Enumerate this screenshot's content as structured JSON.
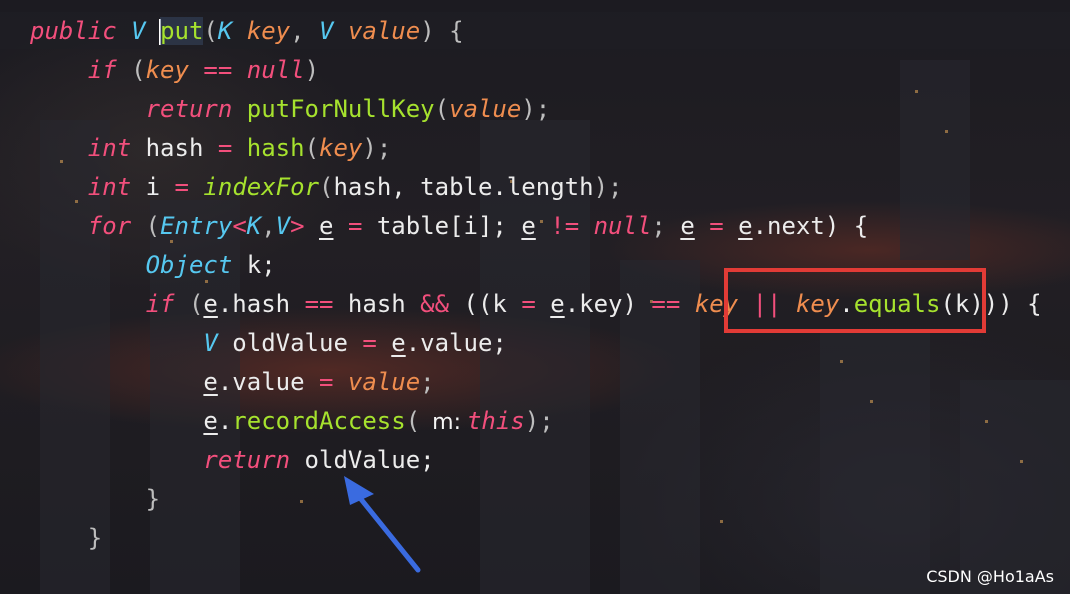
{
  "editor": {
    "lines": [
      [
        {
          "t": "public",
          "c": "kw",
          "id": "public-keyword"
        },
        {
          "t": " ",
          "c": "txt"
        },
        {
          "t": "V",
          "c": "ty",
          "id": "return-type"
        },
        {
          "t": " ",
          "c": "txt"
        },
        {
          "caret": true
        },
        {
          "t": "put",
          "c": "fn put-bg",
          "id": "method-name-put"
        },
        {
          "t": "(",
          "c": "pun"
        },
        {
          "t": "K",
          "c": "ty"
        },
        {
          "t": " ",
          "c": "txt"
        },
        {
          "t": "key",
          "c": "par"
        },
        {
          "t": ", ",
          "c": "pun"
        },
        {
          "t": "V",
          "c": "ty"
        },
        {
          "t": " ",
          "c": "txt"
        },
        {
          "t": "value",
          "c": "par"
        },
        {
          "t": ") {",
          "c": "pun"
        }
      ],
      [
        {
          "t": "    ",
          "c": "txt"
        },
        {
          "t": "if",
          "c": "kw"
        },
        {
          "t": " (",
          "c": "pun"
        },
        {
          "t": "key",
          "c": "par"
        },
        {
          "t": " == ",
          "c": "op"
        },
        {
          "t": "null",
          "c": "kw"
        },
        {
          "t": ")",
          "c": "pun"
        }
      ],
      [
        {
          "t": "        ",
          "c": "txt"
        },
        {
          "t": "return",
          "c": "kw"
        },
        {
          "t": " ",
          "c": "txt"
        },
        {
          "t": "putForNullKey",
          "c": "fn"
        },
        {
          "t": "(",
          "c": "pun"
        },
        {
          "t": "value",
          "c": "par"
        },
        {
          "t": ");",
          "c": "pun"
        }
      ],
      [
        {
          "t": "    ",
          "c": "txt"
        },
        {
          "t": "int",
          "c": "kw"
        },
        {
          "t": " hash ",
          "c": "txt"
        },
        {
          "t": "=",
          "c": "op"
        },
        {
          "t": " ",
          "c": "txt"
        },
        {
          "t": "hash",
          "c": "fn"
        },
        {
          "t": "(",
          "c": "pun"
        },
        {
          "t": "key",
          "c": "par"
        },
        {
          "t": ");",
          "c": "pun"
        }
      ],
      [
        {
          "t": "    ",
          "c": "txt"
        },
        {
          "t": "int",
          "c": "kw"
        },
        {
          "t": " i ",
          "c": "txt"
        },
        {
          "t": "=",
          "c": "op"
        },
        {
          "t": " ",
          "c": "txt"
        },
        {
          "t": "indexFor",
          "c": "fni"
        },
        {
          "t": "(",
          "c": "pun"
        },
        {
          "t": "hash, table.length",
          "c": "txt"
        },
        {
          "t": ");",
          "c": "pun"
        }
      ],
      [
        {
          "t": "    ",
          "c": "txt"
        },
        {
          "t": "for",
          "c": "kw"
        },
        {
          "t": " (",
          "c": "pun"
        },
        {
          "t": "Entry",
          "c": "ty"
        },
        {
          "t": "<",
          "c": "op"
        },
        {
          "t": "K",
          "c": "ty"
        },
        {
          "t": ",",
          "c": "pun"
        },
        {
          "t": "V",
          "c": "ty"
        },
        {
          "t": ">",
          "c": "op"
        },
        {
          "t": " ",
          "c": "txt"
        },
        {
          "t": "e",
          "c": "txt ul"
        },
        {
          "t": " ",
          "c": "txt"
        },
        {
          "t": "=",
          "c": "op"
        },
        {
          "t": " table[i]; ",
          "c": "txt"
        },
        {
          "t": "e",
          "c": "txt ul"
        },
        {
          "t": " ",
          "c": "txt"
        },
        {
          "t": "!=",
          "c": "op"
        },
        {
          "t": " ",
          "c": "txt"
        },
        {
          "t": "null",
          "c": "kw"
        },
        {
          "t": "; ",
          "c": "pun"
        },
        {
          "t": "e",
          "c": "txt ul"
        },
        {
          "t": " ",
          "c": "txt"
        },
        {
          "t": "=",
          "c": "op"
        },
        {
          "t": " ",
          "c": "txt"
        },
        {
          "t": "e",
          "c": "txt ul"
        },
        {
          "t": ".next) {",
          "c": "txt"
        }
      ],
      [
        {
          "t": "        ",
          "c": "txt"
        },
        {
          "t": "Object",
          "c": "ty"
        },
        {
          "t": " k;",
          "c": "txt"
        }
      ],
      [
        {
          "t": "        ",
          "c": "txt"
        },
        {
          "t": "if",
          "c": "kw"
        },
        {
          "t": " (",
          "c": "pun"
        },
        {
          "t": "e",
          "c": "txt ul"
        },
        {
          "t": ".hash ",
          "c": "txt"
        },
        {
          "t": "==",
          "c": "op"
        },
        {
          "t": " hash ",
          "c": "txt"
        },
        {
          "t": "&&",
          "c": "op"
        },
        {
          "t": " ((k ",
          "c": "txt"
        },
        {
          "t": "=",
          "c": "op"
        },
        {
          "t": " ",
          "c": "txt"
        },
        {
          "t": "e",
          "c": "txt ul"
        },
        {
          "t": ".key) ",
          "c": "txt"
        },
        {
          "t": "==",
          "c": "op"
        },
        {
          "t": " ",
          "c": "txt"
        },
        {
          "t": "key",
          "c": "par"
        },
        {
          "t": " ",
          "c": "txt"
        },
        {
          "t": "||",
          "c": "op"
        },
        {
          "t": " ",
          "c": "txt"
        },
        {
          "t": "key",
          "c": "par"
        },
        {
          "t": ".",
          "c": "txt"
        },
        {
          "t": "equals",
          "c": "fn"
        },
        {
          "t": "(k))) {",
          "c": "txt"
        }
      ],
      [
        {
          "t": "            ",
          "c": "txt"
        },
        {
          "t": "V",
          "c": "ty"
        },
        {
          "t": " oldValue ",
          "c": "txt"
        },
        {
          "t": "=",
          "c": "op"
        },
        {
          "t": " ",
          "c": "txt"
        },
        {
          "t": "e",
          "c": "txt ul"
        },
        {
          "t": ".value;",
          "c": "txt"
        }
      ],
      [
        {
          "t": "            ",
          "c": "txt"
        },
        {
          "t": "e",
          "c": "txt ul"
        },
        {
          "t": ".value ",
          "c": "txt"
        },
        {
          "t": "=",
          "c": "op"
        },
        {
          "t": " ",
          "c": "txt"
        },
        {
          "t": "value",
          "c": "par"
        },
        {
          "t": ";",
          "c": "pun"
        }
      ],
      [
        {
          "t": "            ",
          "c": "txt"
        },
        {
          "t": "e",
          "c": "txt ul"
        },
        {
          "t": ".",
          "c": "txt"
        },
        {
          "t": "recordAccess",
          "c": "fn"
        },
        {
          "t": "(",
          "c": "pun"
        },
        {
          "hint": "m:"
        },
        {
          "t": "this",
          "c": "kw"
        },
        {
          "t": ");",
          "c": "pun"
        }
      ],
      [
        {
          "t": "            ",
          "c": "txt"
        },
        {
          "t": "return",
          "c": "kw"
        },
        {
          "t": " oldValue;",
          "c": "txt"
        }
      ],
      [
        {
          "t": "        }",
          "c": "pun"
        }
      ],
      [
        {
          "t": "    }",
          "c": "pun"
        }
      ]
    ]
  },
  "annotations": {
    "box_color": "#e23b36",
    "arrow_color": "#3a6be0",
    "arrow_icon": "arrow-pointing-to-oldValue"
  },
  "watermark": {
    "text": "CSDN @Ho1aAs"
  }
}
